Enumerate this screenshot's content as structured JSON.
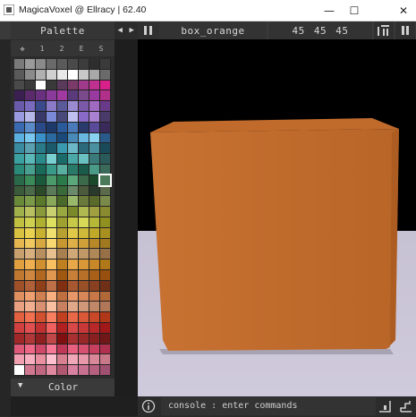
{
  "window": {
    "title": "MagicaVoxel @ Ellracy | 62.40",
    "minimize_glyph": "—",
    "maximize_glyph": "☐",
    "close_glyph": "✕"
  },
  "toolbar": {
    "palette_label": "Palette",
    "left_arrow": "◀",
    "right_arrow": "▶",
    "model_name": "box_orange",
    "dimensions": "45 45 45"
  },
  "palette": {
    "tabs": [
      "✥",
      "1",
      "2",
      "E",
      "S"
    ],
    "selected_index": 107,
    "colors": [
      "#7a7a7a",
      "#9a9a9a",
      "#8a8a8a",
      "#6a6a6a",
      "#5a5a5a",
      "#4a4a4a",
      "#3c3c3c",
      "#2e2e2e",
      "#3a3a3a",
      "#5a5a5a",
      "#8a8a8a",
      "#b0b0b0",
      "#d0d0d0",
      "#e8e8e8",
      "#ffffff",
      "#c8c8c8",
      "#a8a8a8",
      "#6a6a6a",
      "#4a4a4a",
      "#3a3a3a",
      "#ffffff",
      "#3a3a3a",
      "#5a3a5a",
      "#7a3a6a",
      "#a03a8a",
      "#c03090",
      "#d8208a",
      "#3a2050",
      "#5a2a6a",
      "#6a3080",
      "#8a3a9a",
      "#a03aa0",
      "#5a3a7a",
      "#7a4a8a",
      "#9a3aa0",
      "#b0308a",
      "#6a5aaa",
      "#7a6abe",
      "#3a4a8a",
      "#8a7ac8",
      "#5a5a9a",
      "#9a8ad0",
      "#7a5aa8",
      "#a06ac0",
      "#6a3a8a",
      "#9a9ae0",
      "#b8b8e8",
      "#3a3a6a",
      "#7a8ad8",
      "#4a4a7a",
      "#c0c0f0",
      "#8a6ac8",
      "#aa80d0",
      "#4a3a6a",
      "#3a6ab0",
      "#5a8ac8",
      "#2a4a8a",
      "#1e3a6a",
      "#2a5a9a",
      "#4a7ab8",
      "#2a3a6a",
      "#5a4a9a",
      "#3a2a5a",
      "#5ab0e0",
      "#7ac8f0",
      "#3a90c8",
      "#2a6aa0",
      "#1a4a7a",
      "#4a8ab8",
      "#6ab8e0",
      "#8ad0f0",
      "#2a5a8a",
      "#3a8aa0",
      "#5aa0b0",
      "#2a7a8a",
      "#1a5a6a",
      "#3a9ab0",
      "#6ab8c8",
      "#2a6a7a",
      "#4a90a0",
      "#1a4a5a",
      "#3aa0a0",
      "#5ab8b8",
      "#2a8a8a",
      "#7ad0d0",
      "#1a6a6a",
      "#4aa8a8",
      "#6ac0c0",
      "#3a7a7a",
      "#2a5a5a",
      "#2a8a7a",
      "#4aa090",
      "#1a6a5a",
      "#3a9a8a",
      "#5ab0a0",
      "#2a7a6a",
      "#1a5a4a",
      "#4a9a88",
      "#3a6a5a",
      "#2a6a4a",
      "#3a8a5a",
      "#1a5a3a",
      "#4a9a6a",
      "#2a7a4a",
      "#5aa87a",
      "#3a6a4a",
      "#1a4a2a",
      "#4a7a5a",
      "#3a5a3a",
      "#4a6a4a",
      "#2a4a2a",
      "#5a7a5a",
      "#3a6a3a",
      "#6a8a6a",
      "#4a5a3a",
      "#2a3a2a",
      "#5a6a4a",
      "#6a8a3a",
      "#7a9a4a",
      "#5a7a2a",
      "#8aa85a",
      "#4a6a2a",
      "#9ab86a",
      "#6a7a3a",
      "#5a6a2a",
      "#7a8a4a",
      "#a0b04a",
      "#b8c060",
      "#8a9a3a",
      "#c8d070",
      "#9aa840",
      "#7a8a2a",
      "#b0b850",
      "#a0a040",
      "#8a8a30",
      "#c0c040",
      "#d0d050",
      "#b0b030",
      "#e0e060",
      "#a0a030",
      "#c8c848",
      "#d8d858",
      "#b8b838",
      "#909020",
      "#d8c040",
      "#e8d050",
      "#c8b030",
      "#f0e070",
      "#b8a030",
      "#e0c848",
      "#d0b838",
      "#c0a828",
      "#a89020",
      "#e8b850",
      "#f0c860",
      "#d8a840",
      "#f8d870",
      "#c89830",
      "#e0b048",
      "#d0a038",
      "#b88828",
      "#a07820",
      "#c8a070",
      "#d8b080",
      "#b89060",
      "#e8c090",
      "#a88050",
      "#d0a878",
      "#c09868",
      "#b08858",
      "#987048",
      "#e0a040",
      "#f0b050",
      "#d09030",
      "#f8c060",
      "#c08020",
      "#e8a848",
      "#d89838",
      "#c88828",
      "#b07818",
      "#c07830",
      "#d08840",
      "#b06820",
      "#e09850",
      "#a05810",
      "#c88038",
      "#b87028",
      "#a86018",
      "#985010",
      "#a05028",
      "#b06038",
      "#904018",
      "#c07048",
      "#803010",
      "#a85830",
      "#985028",
      "#884020",
      "#703018",
      "#e09060",
      "#f0a070",
      "#d08050",
      "#f8b080",
      "#c07040",
      "#e89868",
      "#d88858",
      "#c87848",
      "#b06838",
      "#e8a080",
      "#f0b090",
      "#d89070",
      "#f8c0a0",
      "#c88060",
      "#e0a888",
      "#d09878",
      "#c08868",
      "#b07858",
      "#e06040",
      "#f07050",
      "#d05030",
      "#f88060",
      "#c04020",
      "#e86848",
      "#d85838",
      "#c84828",
      "#b03818",
      "#d04040",
      "#e05050",
      "#c03030",
      "#f06060",
      "#b02020",
      "#d84848",
      "#c83838",
      "#b82828",
      "#a01818",
      "#a02828",
      "#b03838",
      "#902020",
      "#c04848",
      "#801010",
      "#a83030",
      "#982828",
      "#882020",
      "#701818",
      "#e05878",
      "#f06888",
      "#d04868",
      "#f87898",
      "#c03858",
      "#e86080",
      "#d85070",
      "#c84060",
      "#b03050",
      "#f0a0b0",
      "#f8b0c0",
      "#e890a0",
      "#ffc0d0",
      "#d88090",
      "#f0a8b8",
      "#e898a8",
      "#d88898",
      "#c87888",
      "#ffffff",
      "#d07890",
      "#c06880",
      "#e088a0",
      "#b05870",
      "#d880a0",
      "#c87090",
      "#b86080",
      "#a05070"
    ]
  },
  "color_panel": {
    "label": "Color",
    "arrow": "▼"
  },
  "status": {
    "console_text": "console : enter commands"
  },
  "viewport": {
    "sky_color": "#000000",
    "ground_color": "#c8c3d4",
    "box_color": "#c87232"
  }
}
